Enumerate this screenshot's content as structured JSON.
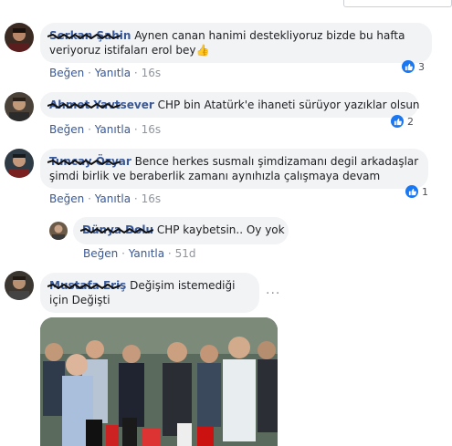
{
  "comments": [
    {
      "author": "Serkan Şahin",
      "text": "Aynen canan hanimi destekliyoruz bizde bu hafta veriyoruz istifaları erol bey",
      "emoji": "👍",
      "like_label": "Beğen",
      "reply_label": "Yanıtla",
      "time": "16s",
      "reaction_count": "3"
    },
    {
      "author": "Ahmet Yavtsever",
      "text": "CHP bin Atatürk'e ihaneti sürüyor yazıklar olsun",
      "like_label": "Beğen",
      "reply_label": "Yanıtla",
      "time": "16s",
      "reaction_count": "2"
    },
    {
      "author": "Tuncay Özyar",
      "text": "Bence herkes susmalı şimdizamanı degil arkadaşlar şimdi birlik ve beraberlik zamanı aynıhızla çalışmaya devam",
      "like_label": "Beğen",
      "reply_label": "Yanıtla",
      "time": "16s",
      "reaction_count": "1"
    },
    {
      "author": "Dünya Dolu",
      "text": "CHP kaybetsin.. Oy yok",
      "like_label": "Beğen",
      "reply_label": "Yanıtla",
      "time": "51d"
    },
    {
      "author": "Mustafa Eriş",
      "text": "Değişim istemediği için Değişti",
      "more": "···"
    }
  ],
  "separator": "·",
  "colors": {
    "link": "#385898",
    "bubble": "#f2f3f5",
    "meta": "#90949c",
    "like_blue": "#1877f2"
  }
}
